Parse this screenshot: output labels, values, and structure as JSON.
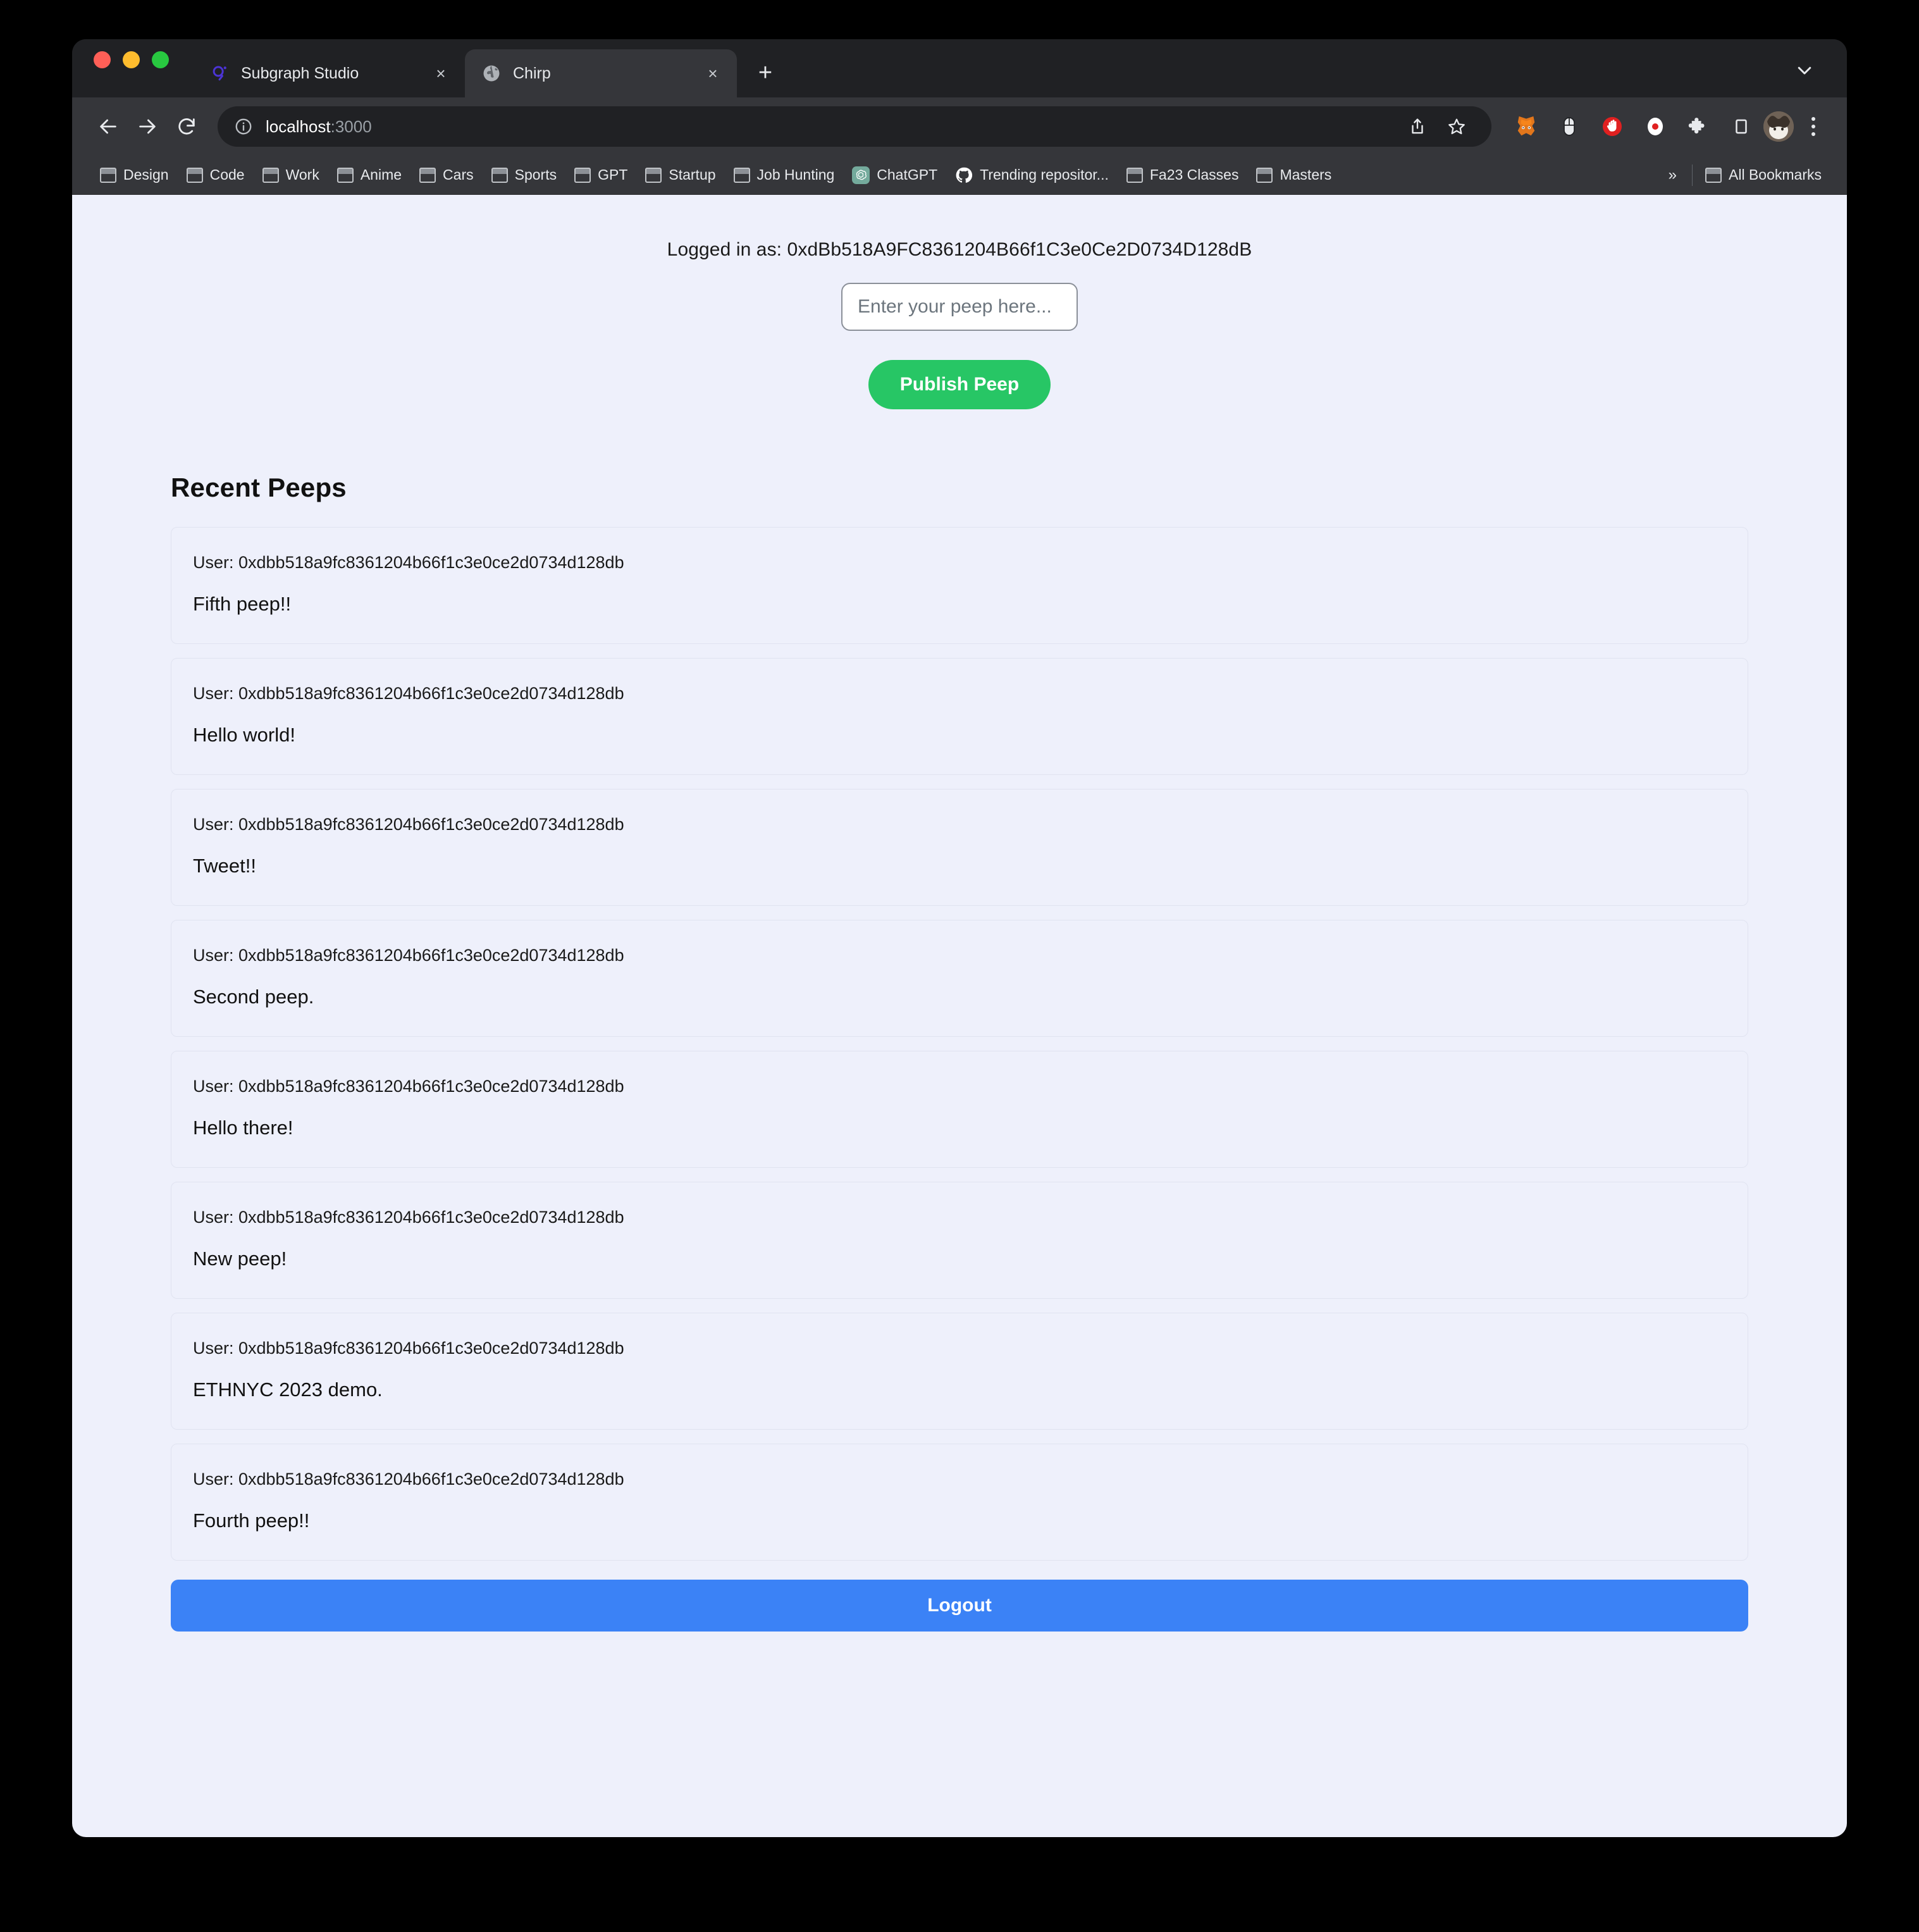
{
  "browser": {
    "window_controls": [
      "close",
      "minimize",
      "maximize"
    ],
    "tabs": [
      {
        "title": "Subgraph Studio",
        "favicon": "graph-logo-icon",
        "active": false,
        "close_label": "×"
      },
      {
        "title": "Chirp",
        "favicon": "globe-icon",
        "active": true,
        "close_label": "×"
      }
    ],
    "new_tab_label": "+",
    "tab_search_icon": "chevron-down-icon",
    "nav": {
      "back_icon": "arrow-left-icon",
      "forward_icon": "arrow-right-icon",
      "reload_icon": "reload-icon"
    },
    "omnibox": {
      "site_info_icon": "info-circle-icon",
      "host": "localhost",
      "port": ":3000",
      "share_icon": "share-icon",
      "bookmark_icon": "star-icon"
    },
    "extensions": [
      {
        "name": "metamask-icon"
      },
      {
        "name": "mouse-icon"
      },
      {
        "name": "ublock-origin-icon"
      },
      {
        "name": "screen-recorder-icon"
      },
      {
        "name": "extensions-puzzle-icon"
      },
      {
        "name": "side-panel-icon"
      }
    ],
    "avatar_icon": "profile-avatar",
    "menu_icon": "three-dot-menu-icon",
    "bookmarks": [
      {
        "label": "Design",
        "icon": "folder-icon"
      },
      {
        "label": "Code",
        "icon": "folder-icon"
      },
      {
        "label": "Work",
        "icon": "folder-icon"
      },
      {
        "label": "Anime",
        "icon": "folder-icon"
      },
      {
        "label": "Cars",
        "icon": "folder-icon"
      },
      {
        "label": "Sports",
        "icon": "folder-icon"
      },
      {
        "label": "GPT",
        "icon": "folder-icon"
      },
      {
        "label": "Startup",
        "icon": "folder-icon"
      },
      {
        "label": "Job Hunting",
        "icon": "folder-icon"
      },
      {
        "label": "ChatGPT",
        "icon": "chatgpt-icon"
      },
      {
        "label": "Trending repositor...",
        "icon": "github-icon"
      },
      {
        "label": "Fa23 Classes",
        "icon": "folder-icon"
      },
      {
        "label": "Masters",
        "icon": "folder-icon"
      }
    ],
    "bookmarks_overflow_label": "»",
    "all_bookmarks_label": "All Bookmarks",
    "all_bookmarks_icon": "folder-icon"
  },
  "page": {
    "logged_in_label": "Logged in as: 0xdBb518A9FC8361204B66f1C3e0Ce2D0734D128dB",
    "compose": {
      "placeholder": "Enter your peep here...",
      "value": "",
      "publish_label": "Publish Peep"
    },
    "feed": {
      "title": "Recent Peeps",
      "user_prefix": "User: ",
      "peeps": [
        {
          "user": "User: 0xdbb518a9fc8361204b66f1c3e0ce2d0734d128db",
          "text": "Fifth peep!!"
        },
        {
          "user": "User: 0xdbb518a9fc8361204b66f1c3e0ce2d0734d128db",
          "text": "Hello world!"
        },
        {
          "user": "User: 0xdbb518a9fc8361204b66f1c3e0ce2d0734d128db",
          "text": "Tweet!!"
        },
        {
          "user": "User: 0xdbb518a9fc8361204b66f1c3e0ce2d0734d128db",
          "text": "Second peep."
        },
        {
          "user": "User: 0xdbb518a9fc8361204b66f1c3e0ce2d0734d128db",
          "text": "Hello there!"
        },
        {
          "user": "User: 0xdbb518a9fc8361204b66f1c3e0ce2d0734d128db",
          "text": "New peep!"
        },
        {
          "user": "User: 0xdbb518a9fc8361204b66f1c3e0ce2d0734d128db",
          "text": "ETHNYC 2023 demo."
        },
        {
          "user": "User: 0xdbb518a9fc8361204b66f1c3e0ce2d0734d128db",
          "text": "Fourth peep!!"
        }
      ]
    },
    "logout_label": "Logout"
  },
  "colors": {
    "page_background": "#eef0fb",
    "publish_green": "#27c665",
    "logout_blue": "#3b82f6",
    "chrome_dark": "#202124",
    "chrome_toolbar": "#35363a"
  }
}
